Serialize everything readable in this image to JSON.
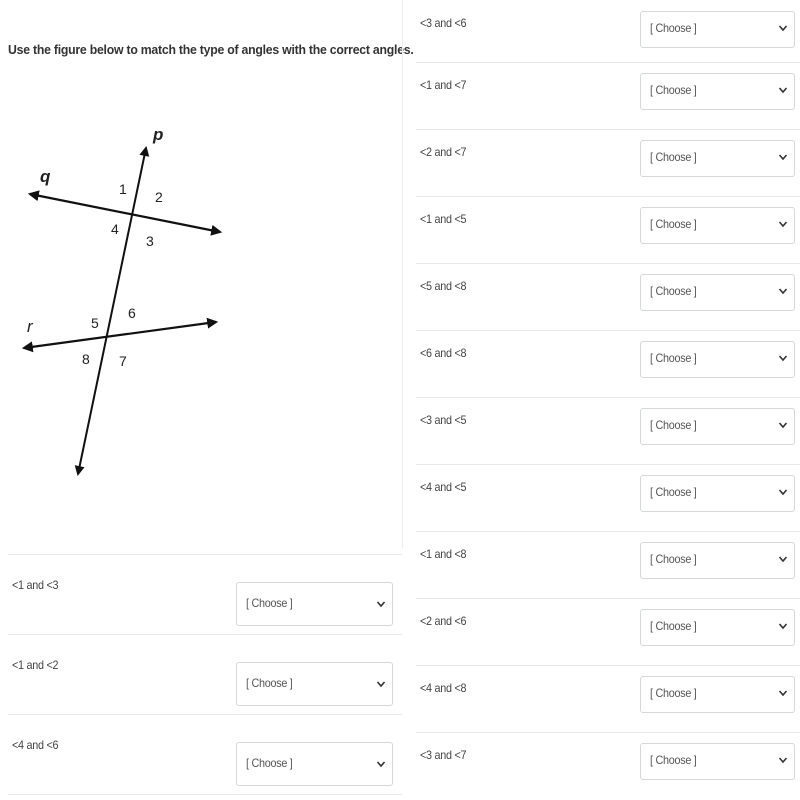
{
  "instructions": "Use the figure below to match the type of angles with the correct angles.",
  "figure": {
    "line_labels": {
      "p": "p",
      "q": "q",
      "r": "r"
    },
    "angle_labels": [
      "1",
      "2",
      "3",
      "4",
      "5",
      "6",
      "7",
      "8"
    ]
  },
  "select_placeholder": "[ Choose ]",
  "left_rows": [
    {
      "label": "<1 and <3",
      "value": "[ Choose ]"
    },
    {
      "label": "<1 and <2",
      "value": "[ Choose ]"
    },
    {
      "label": "<4 and <6",
      "value": "[ Choose ]"
    }
  ],
  "right_rows": [
    {
      "label": "<3 and <6",
      "value": "[ Choose ]"
    },
    {
      "label": "<1 and <7",
      "value": "[ Choose ]"
    },
    {
      "label": "<2 and <7",
      "value": "[ Choose ]"
    },
    {
      "label": "<1 and <5",
      "value": "[ Choose ]"
    },
    {
      "label": "<5 and <8",
      "value": "[ Choose ]"
    },
    {
      "label": "<6 and <8",
      "value": "[ Choose ]"
    },
    {
      "label": "<3 and <5",
      "value": "[ Choose ]"
    },
    {
      "label": "<4 and <5",
      "value": "[ Choose ]"
    },
    {
      "label": "<1 and <8",
      "value": "[ Choose ]"
    },
    {
      "label": "<2 and <6",
      "value": "[ Choose ]"
    },
    {
      "label": "<4 and <8",
      "value": "[ Choose ]"
    },
    {
      "label": "<3 and <7",
      "value": "[ Choose ]"
    }
  ]
}
